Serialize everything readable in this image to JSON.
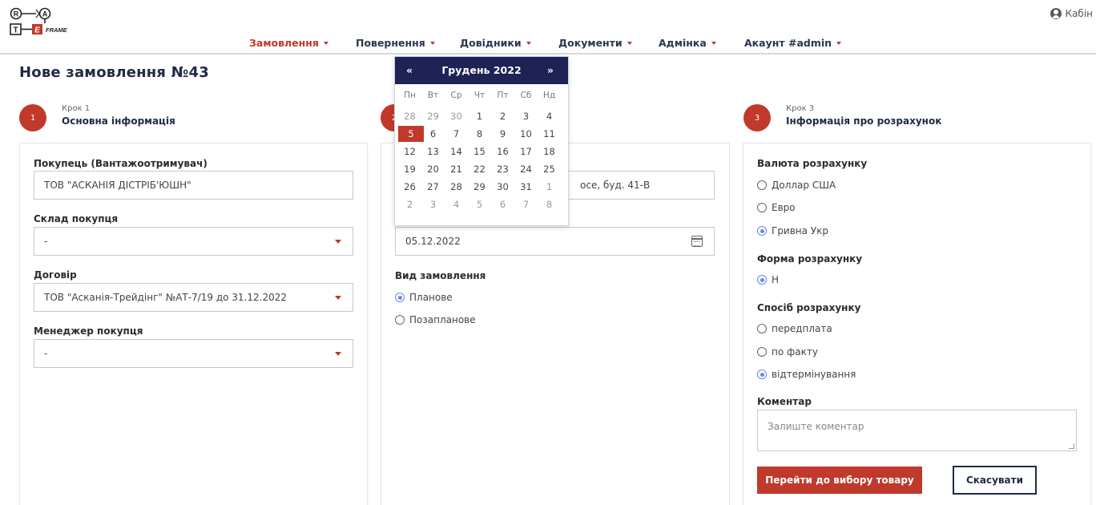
{
  "header": {
    "user_link": "Кабін",
    "nav": [
      {
        "label": "Замовлення",
        "active": true
      },
      {
        "label": "Повернення",
        "active": false
      },
      {
        "label": "Довідники",
        "active": false
      },
      {
        "label": "Документи",
        "active": false
      },
      {
        "label": "Адмінка",
        "active": false
      },
      {
        "label": "Акаунт #admin",
        "active": false
      }
    ]
  },
  "page": {
    "title": "Нове замовлення №43"
  },
  "steps": [
    {
      "num": "1",
      "sub": "Крок 1",
      "title": "Основна інформація"
    },
    {
      "num": "2",
      "sub": "",
      "title": ""
    },
    {
      "num": "3",
      "sub": "Крок 3",
      "title": "Інформація про розрахунок"
    }
  ],
  "panel1": {
    "buyer_label": "Покупець (Вантажоотримувач)",
    "buyer_value": "ТОВ \"АСКАНІЯ ДІСТРІБ'ЮШН\"",
    "warehouse_label": "Склад покупця",
    "warehouse_value": "-",
    "contract_label": "Договір",
    "contract_value": "ТОВ \"Асканія-Трейдінг\" №АТ-7/19 до 31.12.2022",
    "manager_label": "Менеджер покупця",
    "manager_value": "-"
  },
  "panel2": {
    "address_value": "осе, буд. 41-В",
    "date_value": "05.12.2022",
    "order_type_label": "Вид замовлення",
    "order_types": [
      {
        "label": "Планове",
        "checked": true
      },
      {
        "label": "Позапланове",
        "checked": false
      }
    ]
  },
  "panel3": {
    "currency_label": "Валюта розрахунку",
    "currencies": [
      {
        "label": "Доллар США",
        "checked": false
      },
      {
        "label": "Евро",
        "checked": false
      },
      {
        "label": "Гривна Укр",
        "checked": true
      }
    ],
    "form_label": "Форма розрахунку",
    "forms": [
      {
        "label": "Н",
        "checked": true
      }
    ],
    "method_label": "Спосіб розрахунку",
    "methods": [
      {
        "label": "передплата",
        "checked": false
      },
      {
        "label": "по факту",
        "checked": false
      },
      {
        "label": "відтермінування",
        "checked": true
      }
    ],
    "comment_label": "Коментар",
    "comment_placeholder": "Залиште коментар",
    "submit_label": "Перейти до вибору товару",
    "cancel_label": "Скасувати"
  },
  "datepicker": {
    "prev": "«",
    "next": "»",
    "title": "Грудень 2022",
    "weekdays": [
      "Пн",
      "Вт",
      "Ср",
      "Чт",
      "Пт",
      "Сб",
      "Нд"
    ],
    "weeks": [
      [
        "28",
        "29",
        "30",
        "1",
        "2",
        "3",
        "4"
      ],
      [
        "5",
        "6",
        "7",
        "8",
        "9",
        "10",
        "11"
      ],
      [
        "12",
        "13",
        "14",
        "15",
        "16",
        "17",
        "18"
      ],
      [
        "19",
        "20",
        "21",
        "22",
        "23",
        "24",
        "25"
      ],
      [
        "26",
        "27",
        "28",
        "29",
        "30",
        "31",
        "1"
      ],
      [
        "2",
        "3",
        "4",
        "5",
        "6",
        "7",
        "8"
      ]
    ],
    "other_month": [
      [
        true,
        true,
        true,
        false,
        false,
        false,
        false
      ],
      [
        false,
        false,
        false,
        false,
        false,
        false,
        false
      ],
      [
        false,
        false,
        false,
        false,
        false,
        false,
        false
      ],
      [
        false,
        false,
        false,
        false,
        false,
        false,
        false
      ],
      [
        false,
        false,
        false,
        false,
        false,
        false,
        true
      ],
      [
        true,
        true,
        true,
        true,
        true,
        true,
        true
      ]
    ],
    "selected": "5"
  },
  "colors": {
    "accent": "#c0392b",
    "navy": "#1e2254",
    "radio_checked": "#6c86d8"
  }
}
